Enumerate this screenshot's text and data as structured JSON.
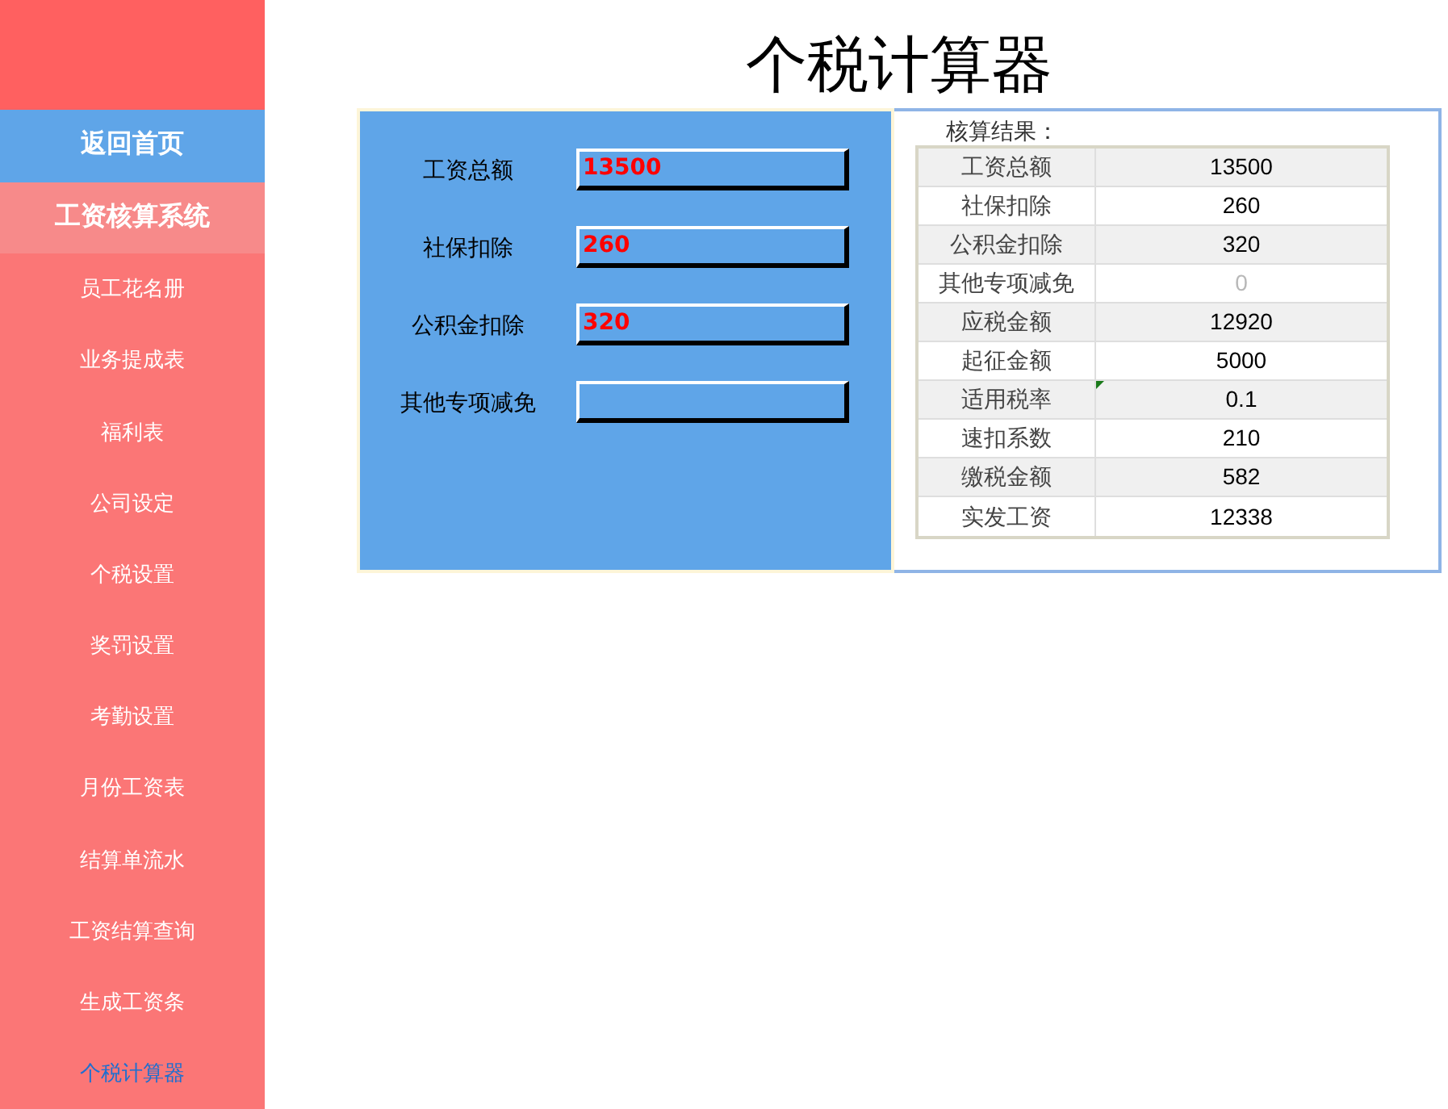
{
  "sidebar": {
    "home_button": "返回首页",
    "system_title": "工资核算系统",
    "items": [
      {
        "label": "员工花名册",
        "selected": false
      },
      {
        "label": "业务提成表",
        "selected": false
      },
      {
        "label": "福利表",
        "selected": false
      },
      {
        "label": "公司设定",
        "selected": false
      },
      {
        "label": "个税设置",
        "selected": false
      },
      {
        "label": "奖罚设置",
        "selected": false
      },
      {
        "label": "考勤设置",
        "selected": false
      },
      {
        "label": "月份工资表",
        "selected": false
      },
      {
        "label": "结算单流水",
        "selected": false
      },
      {
        "label": "工资结算查询",
        "selected": false
      },
      {
        "label": "生成工资条",
        "selected": false
      },
      {
        "label": "个税计算器",
        "selected": true
      }
    ]
  },
  "title": "个税计算器",
  "inputs": [
    {
      "label": "工资总额",
      "value": "13500"
    },
    {
      "label": "社保扣除",
      "value": "260"
    },
    {
      "label": "公积金扣除",
      "value": "320"
    },
    {
      "label": "其他专项减免"
    }
  ],
  "results": {
    "heading": "核算结果：",
    "rows": [
      {
        "name": "工资总额",
        "value": "13500",
        "faint": false,
        "marked": false
      },
      {
        "name": "社保扣除",
        "value": "260",
        "faint": false,
        "marked": false
      },
      {
        "name": "公积金扣除",
        "value": "320",
        "faint": false,
        "marked": false
      },
      {
        "name": "其他专项减免",
        "value": "0",
        "faint": true,
        "marked": false
      },
      {
        "name": "应税金额",
        "value": "12920",
        "faint": false,
        "marked": false
      },
      {
        "name": "起征金额",
        "value": "5000",
        "faint": false,
        "marked": false
      },
      {
        "name": "适用税率",
        "value": "0.1",
        "faint": false,
        "marked": true
      },
      {
        "name": "速扣系数",
        "value": "210",
        "faint": false,
        "marked": false
      },
      {
        "name": "缴税金额",
        "value": "582",
        "faint": false,
        "marked": false
      },
      {
        "name": "实发工资",
        "value": "12338",
        "faint": false,
        "marked": false
      }
    ]
  }
}
